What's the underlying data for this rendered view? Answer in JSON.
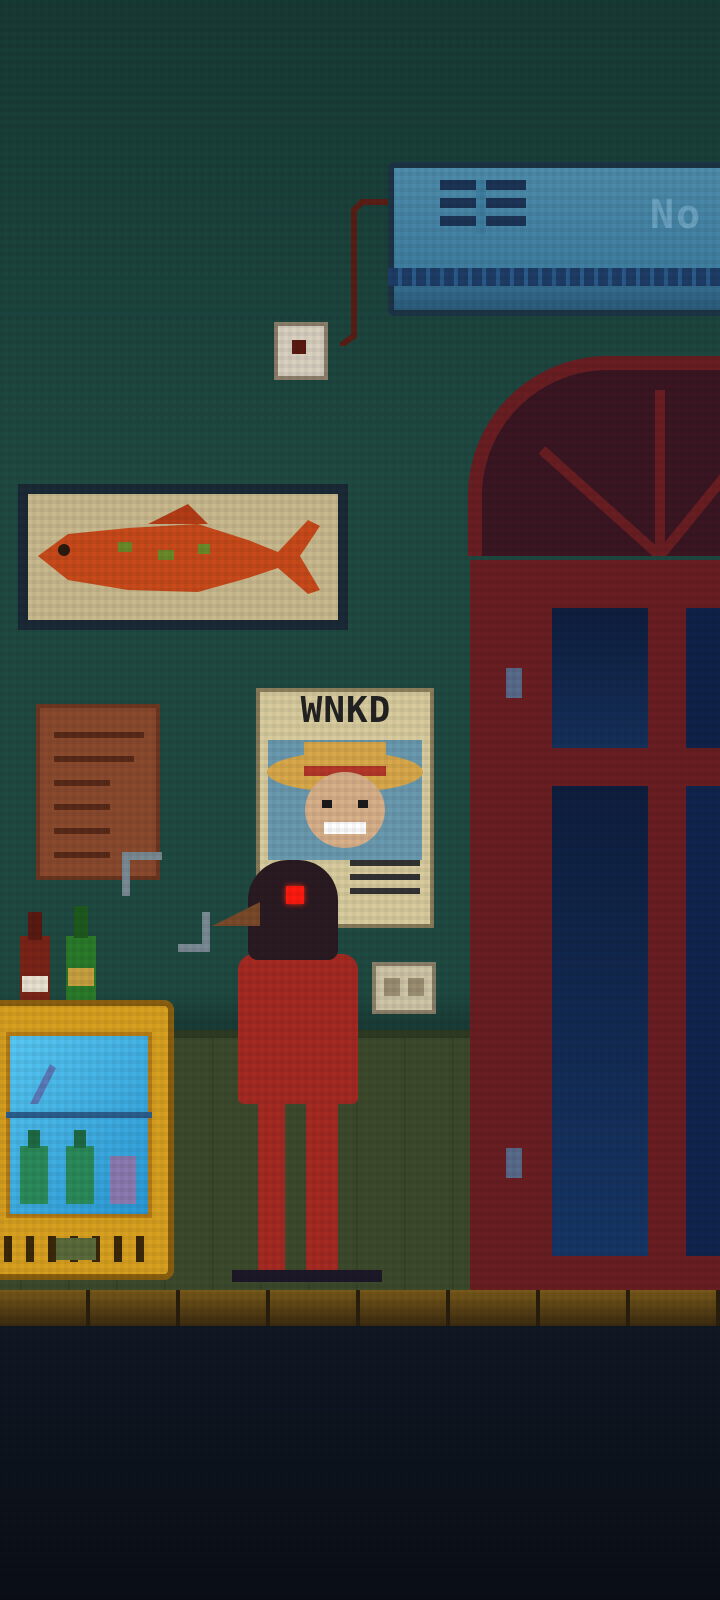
{
  "scene": {
    "name": "bar-interior",
    "ac_unit": {
      "label": "No"
    },
    "wanted_poster": {
      "title": "WNKD"
    },
    "colors": {
      "wall": "#1f4a42",
      "door": "#6a1e22",
      "fridge": "#d8a020",
      "fridge_glass": "#3aaee4",
      "figure_eye": "#ff1a10",
      "figure_body": "#a42a22"
    },
    "icons": [
      "air-conditioner-icon",
      "wall-socket-icon",
      "fish-painting-icon",
      "wanted-poster-icon",
      "note-paper-icon",
      "light-switch-icon",
      "door-icon",
      "fridge-icon",
      "bottle-icon",
      "plague-doctor-figure-icon",
      "selection-cursor-icon"
    ]
  }
}
